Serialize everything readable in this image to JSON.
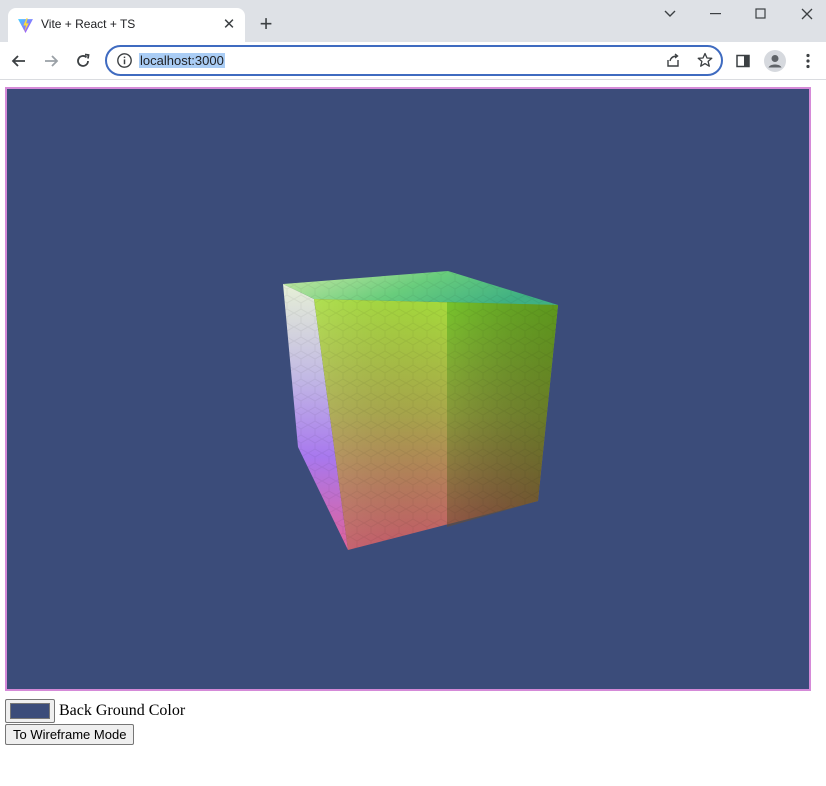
{
  "browser": {
    "tab_title": "Vite + React + TS",
    "tab_close_glyph": "✕",
    "new_tab_glyph": "+",
    "url": "localhost:3000",
    "icons": {
      "favicon": "vite-logo-icon",
      "back": "arrow-left-icon",
      "forward": "arrow-right-icon",
      "reload": "reload-icon",
      "site_info": "info-circle-icon",
      "share": "share-icon",
      "bookmark": "star-icon",
      "side_panel": "side-panel-icon",
      "profile": "profile-avatar-icon",
      "menu": "kebab-menu-icon",
      "tab_search": "chevron-down-icon",
      "minimize": "minimize-icon",
      "maximize": "maximize-icon",
      "close": "close-icon"
    }
  },
  "scene": {
    "background_color": "#3b4c7a",
    "frame_border_color": "#d58ad8",
    "object": "rgb-gradient-cube"
  },
  "controls": {
    "background_color_value": "#3b4c7a",
    "background_color_label": "Back Ground Color",
    "wireframe_button_label": "To Wireframe Mode"
  }
}
